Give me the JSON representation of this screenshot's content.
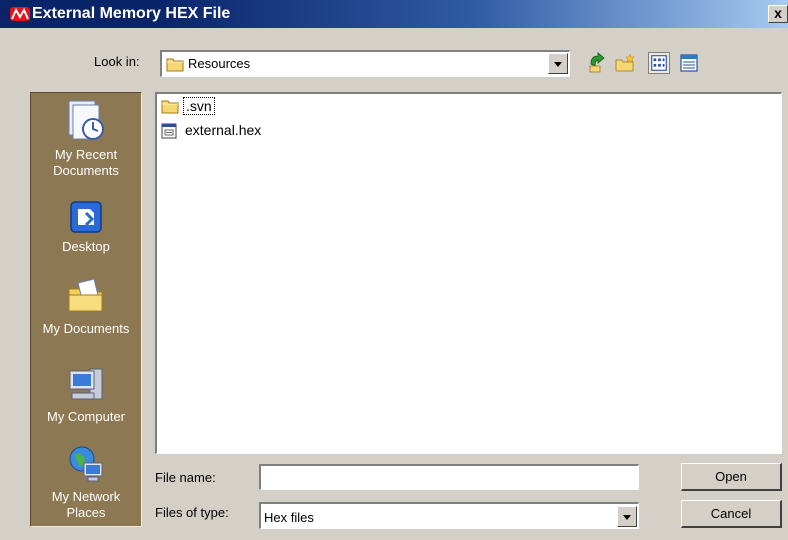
{
  "window": {
    "title": "External Memory HEX File",
    "close_glyph": "x"
  },
  "toolbar": {
    "lookin_label": "Look in:",
    "lookin_value": "Resources",
    "icons": [
      "up-one-level-icon",
      "new-folder-icon",
      "list-view-icon",
      "details-view-icon"
    ]
  },
  "places": [
    {
      "label": "My Recent Documents",
      "icon": "recent-documents-icon"
    },
    {
      "label": "Desktop",
      "icon": "desktop-icon"
    },
    {
      "label": "My Documents",
      "icon": "my-documents-icon"
    },
    {
      "label": "My Computer",
      "icon": "my-computer-icon"
    },
    {
      "label": "My Network Places",
      "icon": "network-places-icon"
    }
  ],
  "files": [
    {
      "name": ".svn",
      "icon": "folder-icon",
      "focused": true
    },
    {
      "name": "external.hex",
      "icon": "hex-file-icon",
      "focused": false
    }
  ],
  "form": {
    "filename_label": "File name:",
    "filename_value": "",
    "filetype_label": "Files of type:",
    "filetype_value": "Hex files"
  },
  "buttons": {
    "open": "Open",
    "cancel": "Cancel"
  },
  "colors": {
    "title_bar": "#0a246a",
    "places_bar": "#8c7853",
    "dialog_bg": "#d4d0c8"
  }
}
